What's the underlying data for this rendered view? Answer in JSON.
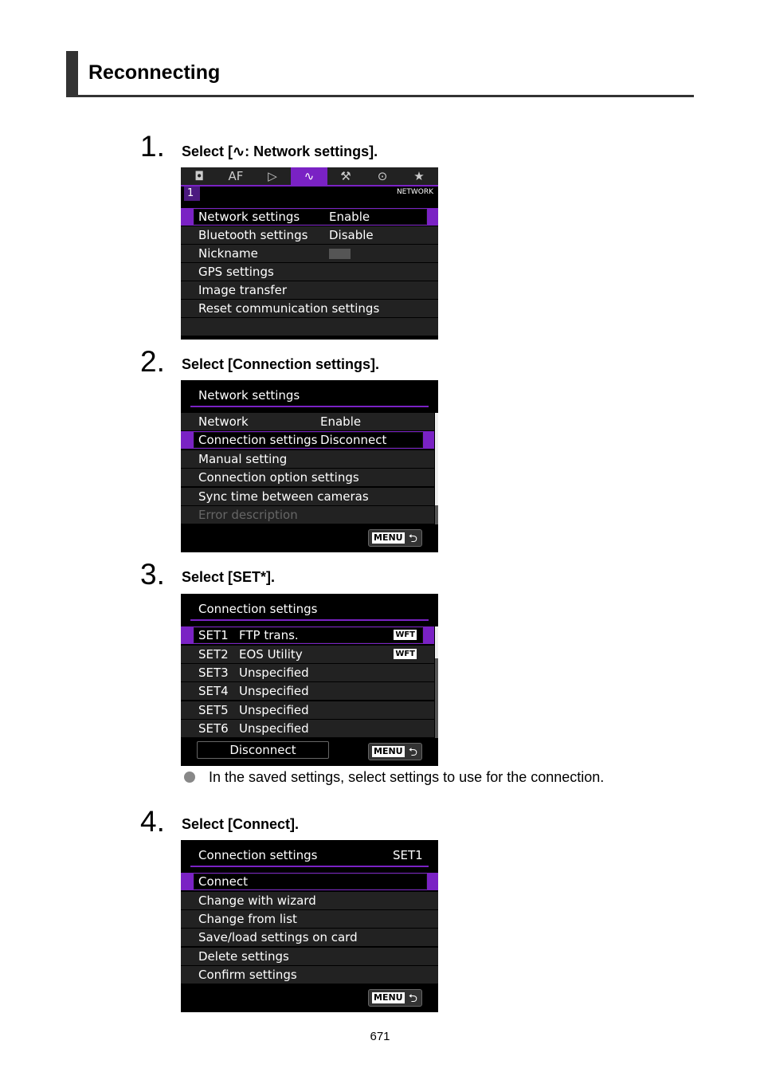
{
  "section": {
    "title": "Reconnecting"
  },
  "steps": [
    {
      "number": "1.",
      "text_prefix": "Select [",
      "icon": "network-icon",
      "text_suffix": ": Network settings]."
    },
    {
      "number": "2.",
      "text": "Select [Connection settings]."
    },
    {
      "number": "3.",
      "text": "Select [SET*]."
    },
    {
      "number": "4.",
      "text": "Select [Connect]."
    }
  ],
  "screen1": {
    "tabs": [
      "camera-icon",
      "AF",
      "playback-icon",
      "network-icon",
      "wrench-icon",
      "custom-icon",
      "star-icon"
    ],
    "tab_glyphs": [
      "◘",
      "AF",
      "▷",
      "∿",
      "⚒",
      "⊙",
      "★"
    ],
    "active_tab": 3,
    "page": "1",
    "page_label": "NETWORK",
    "items": [
      {
        "label": "Network settings",
        "value": "Enable",
        "selected": true
      },
      {
        "label": "Bluetooth settings",
        "value": "Disable"
      },
      {
        "label": "Nickname",
        "value": ""
      },
      {
        "label": "GPS settings",
        "value": ""
      },
      {
        "label": "Image transfer",
        "value": ""
      },
      {
        "label": "Reset communication settings",
        "value": ""
      }
    ]
  },
  "screen2": {
    "title": "Network settings",
    "items": [
      {
        "label": "Network",
        "value": "Enable"
      },
      {
        "label": "Connection settings",
        "value": "Disconnect",
        "selected": true
      },
      {
        "label": "Manual setting",
        "value": ""
      },
      {
        "label": "Connection option settings",
        "value": ""
      },
      {
        "label": "Sync time between cameras",
        "value": ""
      },
      {
        "label": "Error description",
        "value": "",
        "disabled": true
      }
    ],
    "menu_label": "MENU"
  },
  "screen3": {
    "title": "Connection settings",
    "items": [
      {
        "set": "SET1",
        "name": "FTP trans.",
        "badge": "WFT",
        "selected": true
      },
      {
        "set": "SET2",
        "name": "EOS Utility",
        "badge": "WFT"
      },
      {
        "set": "SET3",
        "name": "Unspecified",
        "badge": ""
      },
      {
        "set": "SET4",
        "name": "Unspecified",
        "badge": ""
      },
      {
        "set": "SET5",
        "name": "Unspecified",
        "badge": ""
      },
      {
        "set": "SET6",
        "name": "Unspecified",
        "badge": ""
      }
    ],
    "disconnect_label": "Disconnect",
    "menu_label": "MENU"
  },
  "bullet_note": "In the saved settings, select settings to use for the connection.",
  "screen4": {
    "title": "Connection settings",
    "set_label": "SET1",
    "items": [
      {
        "label": "Connect",
        "selected": true
      },
      {
        "label": "Change with wizard"
      },
      {
        "label": "Change from list"
      },
      {
        "label": "Save/load settings on card"
      },
      {
        "label": "Delete settings"
      },
      {
        "label": "Confirm settings"
      }
    ],
    "menu_label": "MENU"
  },
  "page_number": "671",
  "colors": {
    "accent": "#7a22c4",
    "heading_bar": "#333333"
  }
}
